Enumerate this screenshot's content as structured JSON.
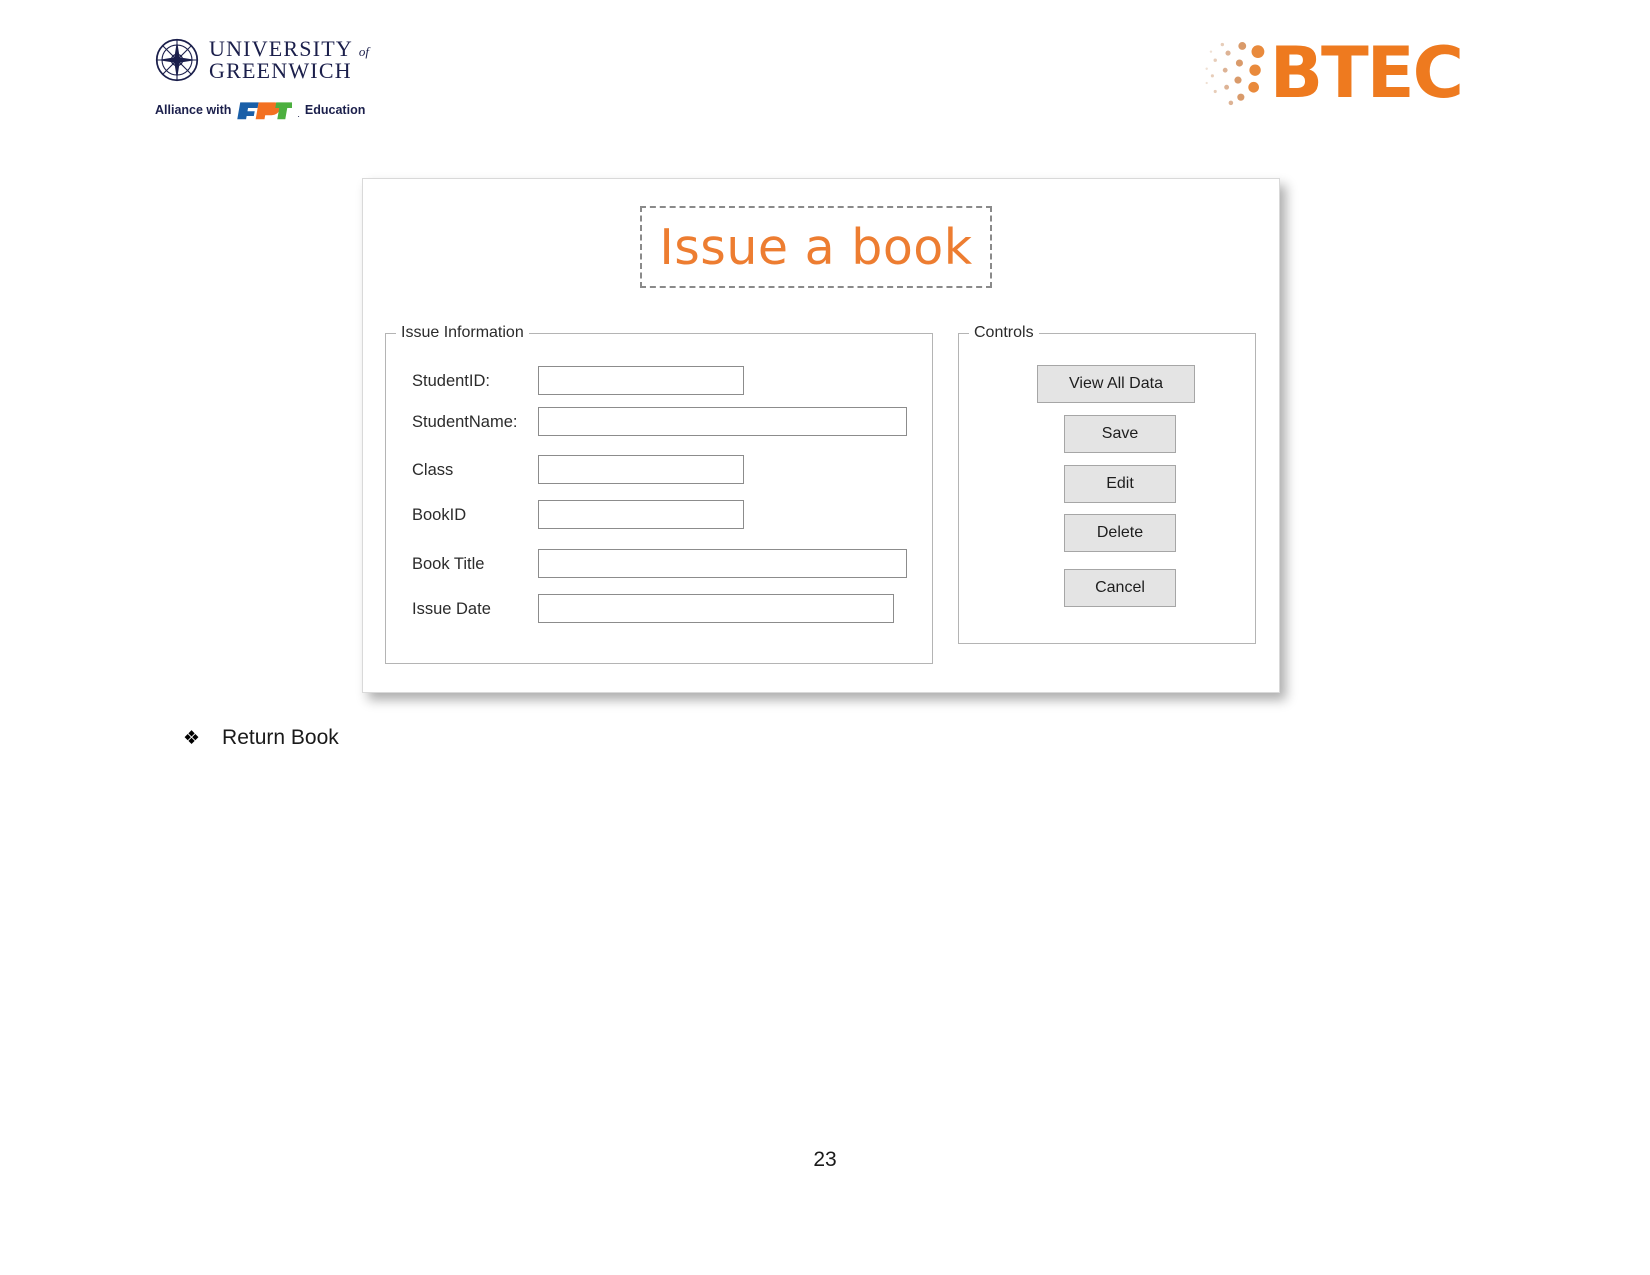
{
  "document": {
    "page_number": "23",
    "bullet": {
      "glyph": "❖",
      "label": "Return Book"
    }
  },
  "header": {
    "university_logo": {
      "icon": "compass-rose-icon",
      "line1": "UNIVERSITY",
      "line1_suffix": "of",
      "line2": "GREENWICH"
    },
    "alliance": {
      "prefix": "Alliance with",
      "brand": "FPT",
      "brand_letters": [
        "F",
        "P",
        "T"
      ],
      "suffix": "Education",
      "colors": {
        "f": "#1a5fa8",
        "p": "#f37021",
        "t": "#4caf3f"
      }
    },
    "btec_logo": {
      "word": "BTEC",
      "icon": "btec-dots-icon",
      "color": "#ee7a1f"
    }
  },
  "form": {
    "title": "Issue a book",
    "title_color": "#ed7d31",
    "issue_information": {
      "legend": "Issue Information",
      "fields": [
        {
          "label": "StudentID:",
          "value": "",
          "width": "short"
        },
        {
          "label": "StudentName:",
          "value": "",
          "width": "long"
        },
        {
          "label": "Class",
          "value": "",
          "width": "short"
        },
        {
          "label": "BookID",
          "value": "",
          "width": "short"
        },
        {
          "label": "Book Title",
          "value": "",
          "width": "long"
        },
        {
          "label": "Issue Date",
          "value": "",
          "width": "date"
        }
      ]
    },
    "controls": {
      "legend": "Controls",
      "buttons": [
        {
          "label": "View All Data"
        },
        {
          "label": "Save"
        },
        {
          "label": "Edit"
        },
        {
          "label": "Delete"
        },
        {
          "label": "Cancel"
        }
      ]
    }
  }
}
